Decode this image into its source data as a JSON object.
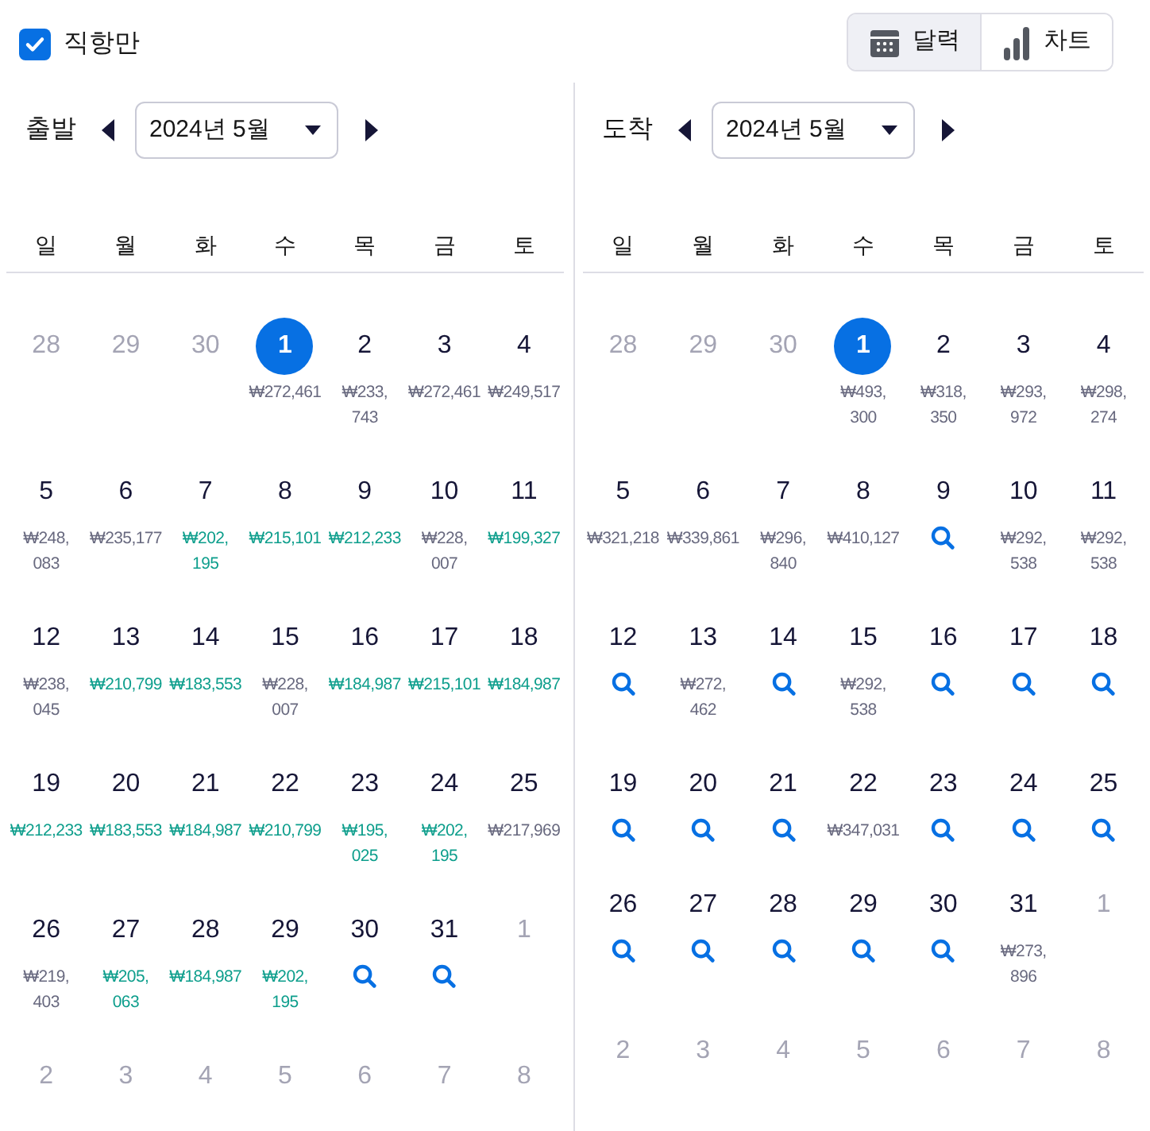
{
  "direct_only": {
    "label": "직항만",
    "checked": true
  },
  "view_toggle": [
    {
      "label": "달력",
      "selected": true
    },
    {
      "label": "차트",
      "selected": false
    }
  ],
  "calendars": [
    {
      "label": "출발",
      "month": "2024년 5월",
      "weekdays": [
        "일",
        "월",
        "화",
        "수",
        "목",
        "금",
        "토"
      ],
      "days": [
        {
          "day": "28",
          "kind": "outside",
          "selected": false
        },
        {
          "day": "29",
          "kind": "outside",
          "selected": false
        },
        {
          "day": "30",
          "kind": "outside",
          "selected": false
        },
        {
          "day": "1",
          "kind": "price",
          "price": [
            "₩272,461"
          ],
          "cheap": false,
          "selected": true
        },
        {
          "day": "2",
          "kind": "price",
          "price": [
            "₩233,",
            "743"
          ],
          "cheap": false,
          "selected": false
        },
        {
          "day": "3",
          "kind": "price",
          "price": [
            "₩272,461"
          ],
          "cheap": false,
          "selected": false
        },
        {
          "day": "4",
          "kind": "price",
          "price": [
            "₩249,517"
          ],
          "cheap": false,
          "selected": false
        },
        {
          "day": "5",
          "kind": "price",
          "price": [
            "₩248,",
            "083"
          ],
          "cheap": false,
          "selected": false
        },
        {
          "day": "6",
          "kind": "price",
          "price": [
            "₩235,177"
          ],
          "cheap": false,
          "selected": false
        },
        {
          "day": "7",
          "kind": "price",
          "price": [
            "₩202,",
            "195"
          ],
          "cheap": true,
          "selected": false
        },
        {
          "day": "8",
          "kind": "price",
          "price": [
            "₩215,101"
          ],
          "cheap": true,
          "selected": false
        },
        {
          "day": "9",
          "kind": "price",
          "price": [
            "₩212,233"
          ],
          "cheap": true,
          "selected": false
        },
        {
          "day": "10",
          "kind": "price",
          "price": [
            "₩228,",
            "007"
          ],
          "cheap": false,
          "selected": false
        },
        {
          "day": "11",
          "kind": "price",
          "price": [
            "₩199,327"
          ],
          "cheap": true,
          "selected": false
        },
        {
          "day": "12",
          "kind": "price",
          "price": [
            "₩238,",
            "045"
          ],
          "cheap": false,
          "selected": false
        },
        {
          "day": "13",
          "kind": "price",
          "price": [
            "₩210,799"
          ],
          "cheap": true,
          "selected": false
        },
        {
          "day": "14",
          "kind": "price",
          "price": [
            "₩183,553"
          ],
          "cheap": true,
          "selected": false
        },
        {
          "day": "15",
          "kind": "price",
          "price": [
            "₩228,",
            "007"
          ],
          "cheap": false,
          "selected": false
        },
        {
          "day": "16",
          "kind": "price",
          "price": [
            "₩184,987"
          ],
          "cheap": true,
          "selected": false
        },
        {
          "day": "17",
          "kind": "price",
          "price": [
            "₩215,101"
          ],
          "cheap": true,
          "selected": false
        },
        {
          "day": "18",
          "kind": "price",
          "price": [
            "₩184,987"
          ],
          "cheap": true,
          "selected": false
        },
        {
          "day": "19",
          "kind": "price",
          "price": [
            "₩212,233"
          ],
          "cheap": true,
          "selected": false
        },
        {
          "day": "20",
          "kind": "price",
          "price": [
            "₩183,553"
          ],
          "cheap": true,
          "selected": false
        },
        {
          "day": "21",
          "kind": "price",
          "price": [
            "₩184,987"
          ],
          "cheap": true,
          "selected": false
        },
        {
          "day": "22",
          "kind": "price",
          "price": [
            "₩210,799"
          ],
          "cheap": true,
          "selected": false
        },
        {
          "day": "23",
          "kind": "price",
          "price": [
            "₩195,",
            "025"
          ],
          "cheap": true,
          "selected": false
        },
        {
          "day": "24",
          "kind": "price",
          "price": [
            "₩202,",
            "195"
          ],
          "cheap": true,
          "selected": false
        },
        {
          "day": "25",
          "kind": "price",
          "price": [
            "₩217,969"
          ],
          "cheap": false,
          "selected": false
        },
        {
          "day": "26",
          "kind": "price",
          "price": [
            "₩219,",
            "403"
          ],
          "cheap": false,
          "selected": false
        },
        {
          "day": "27",
          "kind": "price",
          "price": [
            "₩205,",
            "063"
          ],
          "cheap": true,
          "selected": false
        },
        {
          "day": "28",
          "kind": "price",
          "price": [
            "₩184,987"
          ],
          "cheap": true,
          "selected": false
        },
        {
          "day": "29",
          "kind": "price",
          "price": [
            "₩202,",
            "195"
          ],
          "cheap": true,
          "selected": false
        },
        {
          "day": "30",
          "kind": "search",
          "selected": false
        },
        {
          "day": "31",
          "kind": "search",
          "selected": false
        },
        {
          "day": "1",
          "kind": "outside",
          "selected": false
        },
        {
          "day": "2",
          "kind": "outside",
          "selected": false
        },
        {
          "day": "3",
          "kind": "outside",
          "selected": false
        },
        {
          "day": "4",
          "kind": "outside",
          "selected": false
        },
        {
          "day": "5",
          "kind": "outside",
          "selected": false
        },
        {
          "day": "6",
          "kind": "outside",
          "selected": false
        },
        {
          "day": "7",
          "kind": "outside",
          "selected": false
        },
        {
          "day": "8",
          "kind": "outside",
          "selected": false
        }
      ]
    },
    {
      "label": "도착",
      "month": "2024년 5월",
      "weekdays": [
        "일",
        "월",
        "화",
        "수",
        "목",
        "금",
        "토"
      ],
      "days": [
        {
          "day": "28",
          "kind": "outside",
          "selected": false
        },
        {
          "day": "29",
          "kind": "outside",
          "selected": false
        },
        {
          "day": "30",
          "kind": "outside",
          "selected": false
        },
        {
          "day": "1",
          "kind": "price",
          "price": [
            "₩493,",
            "300"
          ],
          "cheap": false,
          "selected": true
        },
        {
          "day": "2",
          "kind": "price",
          "price": [
            "₩318,",
            "350"
          ],
          "cheap": false,
          "selected": false
        },
        {
          "day": "3",
          "kind": "price",
          "price": [
            "₩293,",
            "972"
          ],
          "cheap": false,
          "selected": false
        },
        {
          "day": "4",
          "kind": "price",
          "price": [
            "₩298,",
            "274"
          ],
          "cheap": false,
          "selected": false
        },
        {
          "day": "5",
          "kind": "price",
          "price": [
            "₩321,218"
          ],
          "cheap": false,
          "selected": false
        },
        {
          "day": "6",
          "kind": "price",
          "price": [
            "₩339,861"
          ],
          "cheap": false,
          "selected": false
        },
        {
          "day": "7",
          "kind": "price",
          "price": [
            "₩296,",
            "840"
          ],
          "cheap": false,
          "selected": false
        },
        {
          "day": "8",
          "kind": "price",
          "price": [
            "₩410,127"
          ],
          "cheap": false,
          "selected": false
        },
        {
          "day": "9",
          "kind": "search",
          "selected": false
        },
        {
          "day": "10",
          "kind": "price",
          "price": [
            "₩292,",
            "538"
          ],
          "cheap": false,
          "selected": false
        },
        {
          "day": "11",
          "kind": "price",
          "price": [
            "₩292,",
            "538"
          ],
          "cheap": false,
          "selected": false
        },
        {
          "day": "12",
          "kind": "search",
          "selected": false
        },
        {
          "day": "13",
          "kind": "price",
          "price": [
            "₩272,",
            "462"
          ],
          "cheap": false,
          "selected": false
        },
        {
          "day": "14",
          "kind": "search",
          "selected": false
        },
        {
          "day": "15",
          "kind": "price",
          "price": [
            "₩292,",
            "538"
          ],
          "cheap": false,
          "selected": false
        },
        {
          "day": "16",
          "kind": "search",
          "selected": false
        },
        {
          "day": "17",
          "kind": "search",
          "selected": false
        },
        {
          "day": "18",
          "kind": "search",
          "selected": false
        },
        {
          "day": "19",
          "kind": "search",
          "selected": false
        },
        {
          "day": "20",
          "kind": "search",
          "selected": false
        },
        {
          "day": "21",
          "kind": "search",
          "selected": false
        },
        {
          "day": "22",
          "kind": "price",
          "price": [
            "₩347,031"
          ],
          "cheap": false,
          "selected": false
        },
        {
          "day": "23",
          "kind": "search",
          "selected": false
        },
        {
          "day": "24",
          "kind": "search",
          "selected": false
        },
        {
          "day": "25",
          "kind": "search",
          "selected": false
        },
        {
          "day": "26",
          "kind": "search",
          "selected": false
        },
        {
          "day": "27",
          "kind": "search",
          "selected": false
        },
        {
          "day": "28",
          "kind": "search",
          "selected": false
        },
        {
          "day": "29",
          "kind": "search",
          "selected": false
        },
        {
          "day": "30",
          "kind": "search",
          "selected": false
        },
        {
          "day": "31",
          "kind": "price",
          "price": [
            "₩273,",
            "896"
          ],
          "cheap": false,
          "selected": false
        },
        {
          "day": "1",
          "kind": "outside",
          "selected": false
        },
        {
          "day": "2",
          "kind": "outside",
          "selected": false
        },
        {
          "day": "3",
          "kind": "outside",
          "selected": false
        },
        {
          "day": "4",
          "kind": "outside",
          "selected": false
        },
        {
          "day": "5",
          "kind": "outside",
          "selected": false
        },
        {
          "day": "6",
          "kind": "outside",
          "selected": false
        },
        {
          "day": "7",
          "kind": "outside",
          "selected": false
        },
        {
          "day": "8",
          "kind": "outside",
          "selected": false
        }
      ]
    }
  ]
}
